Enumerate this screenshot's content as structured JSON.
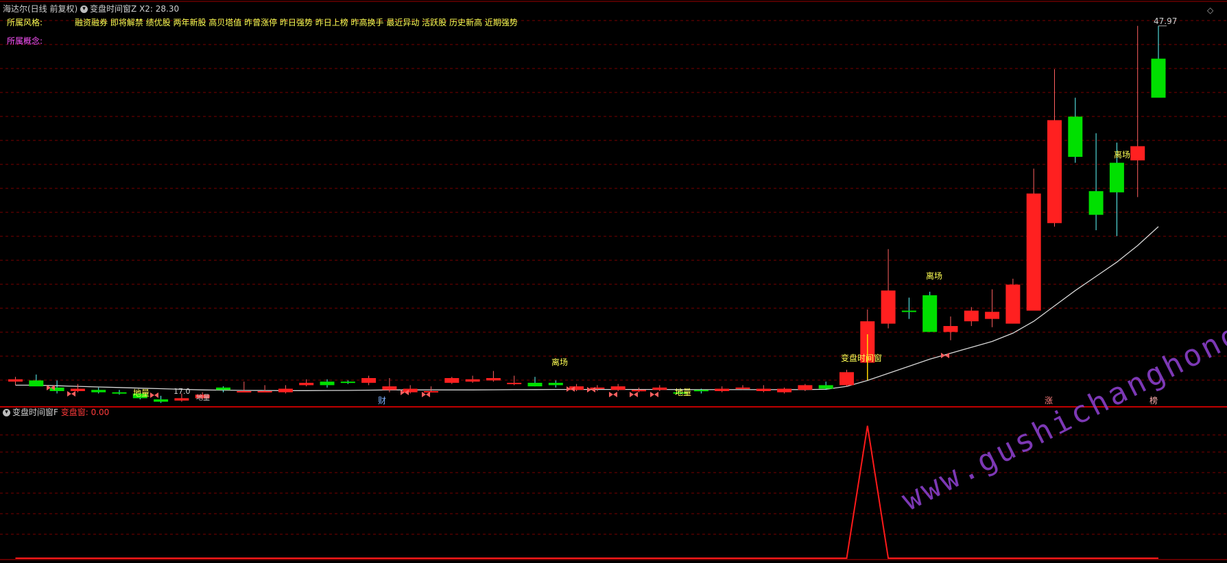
{
  "header": {
    "stock_title": "海达尔(日线 前复权)",
    "indicator_name": "变盘时间窗Z",
    "indicator_value": "X2: 28.30",
    "style_label": "所属风格:",
    "style_values": "融资融券 即将解禁 绩优股 两年新股 高贝塔值 昨曾涨停 昨日强势 昨日上榜 昨高换手 最近异动 活跃股 历史新高 近期强势",
    "concept_label": "所属概念:"
  },
  "sub_panel": {
    "title": "变盘时间窗F",
    "value_label": "变盘窗: 0.00"
  },
  "annotations": {
    "max_price": "47.97",
    "exit_label": "离场",
    "bottom_label": "地量",
    "window_label": "变盘时间窗",
    "cai_label": "财",
    "zhang_label": "涨",
    "bang_label": "榜",
    "low_price_partial": "17.0",
    "di_partial": "地量"
  },
  "watermark": "www.gushichanghong.com",
  "colors": {
    "up": "#ff2020",
    "down": "#00e000",
    "grid": "#7a0000",
    "ma": "#d8d8d8",
    "signal": "#ff1a1a"
  },
  "chart_data": [
    {
      "type": "candlestick",
      "title": "海达尔(日线 前复权)",
      "x": [
        1,
        2,
        3,
        4,
        5,
        6,
        7,
        8,
        9,
        10,
        11,
        12,
        13,
        14,
        15,
        16,
        17,
        18,
        19,
        20,
        21,
        22,
        23,
        24,
        25,
        26,
        27,
        28,
        29,
        30,
        31,
        32,
        33,
        34,
        35,
        36,
        37,
        38,
        39,
        40,
        41,
        42,
        43,
        44,
        45,
        46,
        47,
        48,
        49,
        50,
        51,
        52,
        53,
        54,
        55,
        56
      ],
      "open": [
        17.9,
        18.0,
        17.4,
        17.1,
        17.2,
        17.0,
        16.9,
        16.4,
        16.3,
        16.5,
        17.4,
        17.1,
        17.0,
        17.0,
        17.6,
        17.9,
        17.9,
        17.8,
        17.2,
        17.0,
        17.1,
        17.8,
        17.9,
        18.0,
        17.7,
        17.8,
        17.8,
        17.2,
        17.3,
        17.2,
        17.1,
        17.2,
        17.0,
        17.2,
        17.1,
        17.3,
        17.1,
        17.0,
        17.2,
        17.6,
        17.6,
        19.5,
        22.8,
        23.9,
        25.2,
        22.1,
        23.0,
        23.2,
        22.8,
        23.9,
        31.3,
        40.3,
        34.0,
        36.4,
        36.6,
        45.2
      ],
      "close": [
        18.1,
        17.5,
        17.1,
        17.3,
        17.0,
        16.9,
        16.5,
        16.2,
        16.5,
        16.8,
        17.2,
        17.1,
        17.1,
        17.3,
        17.8,
        17.6,
        17.8,
        18.2,
        17.5,
        17.3,
        17.1,
        18.2,
        18.1,
        18.2,
        17.8,
        17.5,
        17.6,
        17.5,
        17.4,
        17.5,
        17.2,
        17.4,
        16.9,
        17.1,
        17.3,
        17.4,
        17.3,
        17.3,
        17.6,
        17.3,
        18.7,
        23.0,
        25.6,
        23.8,
        22.1,
        22.6,
        23.9,
        23.8,
        26.1,
        33.8,
        40.0,
        36.9,
        32.0,
        33.9,
        37.8,
        41.9
      ],
      "high": [
        18.3,
        18.5,
        18.0,
        17.7,
        17.4,
        17.2,
        17.0,
        16.7,
        16.9,
        17.0,
        17.5,
        17.9,
        17.6,
        17.6,
        18.1,
        18.1,
        18.0,
        18.4,
        18.2,
        17.6,
        17.5,
        18.3,
        18.4,
        18.8,
        18.4,
        18.3,
        18.0,
        17.7,
        17.6,
        17.7,
        17.4,
        17.6,
        17.3,
        17.3,
        17.5,
        17.6,
        17.6,
        17.4,
        17.7,
        17.9,
        18.9,
        24.0,
        29.1,
        25.0,
        25.5,
        23.4,
        24.2,
        25.7,
        26.6,
        35.9,
        44.3,
        41.9,
        38.9,
        38.1,
        47.97,
        47.97
      ],
      "low": [
        17.6,
        17.6,
        16.9,
        17.0,
        16.9,
        16.8,
        16.4,
        16.1,
        16.2,
        16.4,
        17.0,
        17.0,
        17.0,
        16.9,
        17.5,
        17.4,
        17.7,
        17.6,
        17.0,
        16.9,
        17.0,
        17.7,
        17.8,
        17.9,
        17.6,
        17.5,
        17.4,
        17.1,
        17.1,
        17.1,
        17.0,
        17.1,
        16.8,
        16.9,
        17.0,
        17.2,
        17.0,
        16.9,
        17.1,
        17.2,
        17.5,
        19.2,
        22.4,
        23.2,
        22.1,
        21.4,
        22.6,
        22.5,
        22.8,
        23.9,
        31.0,
        36.4,
        30.7,
        30.2,
        33.5,
        44.9
      ],
      "ma": [
        17.6,
        17.6,
        17.55,
        17.5,
        17.45,
        17.4,
        17.35,
        17.3,
        17.25,
        17.2,
        17.18,
        17.16,
        17.15,
        17.14,
        17.14,
        17.15,
        17.16,
        17.18,
        17.2,
        17.2,
        17.2,
        17.2,
        17.2,
        17.21,
        17.22,
        17.23,
        17.24,
        17.24,
        17.24,
        17.24,
        17.24,
        17.24,
        17.23,
        17.22,
        17.22,
        17.22,
        17.22,
        17.22,
        17.23,
        17.25,
        17.5,
        18.0,
        18.6,
        19.2,
        19.8,
        20.3,
        20.8,
        21.3,
        22.0,
        23.0,
        24.3,
        25.6,
        26.8,
        28.0,
        29.4,
        31.0
      ],
      "ylim": [
        16.0,
        49.0
      ],
      "grid": true
    },
    {
      "type": "line",
      "title": "变盘时间窗F",
      "series": [
        {
          "values": [
            0,
            0,
            0,
            0,
            0,
            0,
            0,
            0,
            0,
            0,
            0,
            0,
            0,
            0,
            0,
            0,
            0,
            0,
            0,
            0,
            0,
            0,
            0,
            0,
            0,
            0,
            0,
            0,
            0,
            0,
            0,
            0,
            0,
            0,
            0,
            0,
            0,
            0,
            0,
            0,
            0,
            1,
            0,
            0,
            0,
            0,
            0,
            0,
            0,
            0,
            0,
            0,
            0,
            0,
            0,
            0
          ]
        }
      ],
      "ylim": [
        0,
        1.05
      ]
    }
  ]
}
